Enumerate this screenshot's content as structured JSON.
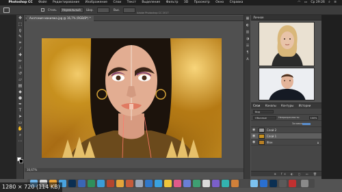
{
  "menubar": {
    "app": "Photoshop CC",
    "items": [
      "Файл",
      "Редактирование",
      "Изображение",
      "Слои",
      "Текст",
      "Выделение",
      "Фильтр",
      "3D",
      "Просмотр",
      "Окно",
      "Справка"
    ],
    "clock": "Ср 29:26"
  },
  "window_title": "Adobe Photoshop CC 2017",
  "options": {
    "style_label": "Стиль",
    "style_value": "Нормальный",
    "width_label": "Шир.",
    "height_label": "Выс."
  },
  "document_tab": {
    "close": "×",
    "name": "Анатомия макияжа.jpg @ 16,7% (RGB/8*) *"
  },
  "status_bar": {
    "zoom": "16,67%"
  },
  "panels": {
    "header": "Личное"
  },
  "layers_panel": {
    "tabs": [
      "Слои",
      "Каналы",
      "Контуры",
      "Истории"
    ],
    "kind_filter": "Вид",
    "blend_mode": "Обычные",
    "opacity_label": "Непрозрачность:",
    "opacity_value": "100%",
    "fill_label": "Заливка:",
    "layers": [
      {
        "name": "Слой 2",
        "selected": false
      },
      {
        "name": "Слой 1",
        "selected": true
      },
      {
        "name": "Фон",
        "selected": false
      }
    ],
    "footer_icons": "⊕ fx ◐ ▢ ▭ 🗑"
  },
  "caption": "1280 × 720 (114 KB)",
  "colors": {
    "gold": "#c7901e",
    "ui_dark": "#3b3b3b",
    "selection": "#5f5f5f"
  },
  "toolbar_icons": [
    "move-icon",
    "marquee-icon",
    "lasso-icon",
    "quick-select-icon",
    "crop-icon",
    "eyedropper-icon",
    "healing-icon",
    "brush-icon",
    "stamp-icon",
    "history-brush-icon",
    "eraser-icon",
    "gradient-icon",
    "blur-icon",
    "dodge-icon",
    "pen-icon",
    "type-icon",
    "path-select-icon",
    "shape-icon",
    "hand-icon",
    "zoom-icon"
  ]
}
